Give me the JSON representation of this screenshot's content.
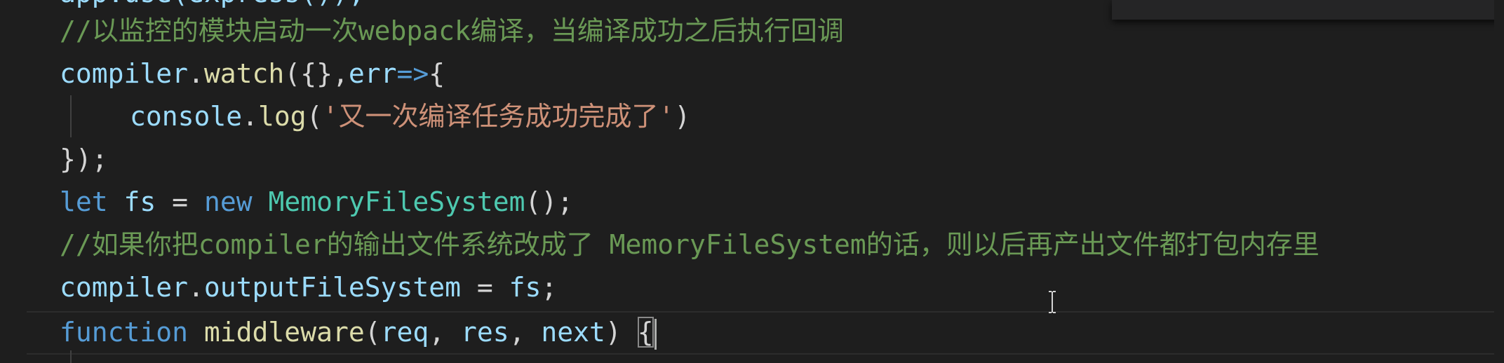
{
  "editor": {
    "partial_top_line": "app.use(express());",
    "lines": [
      {
        "tokens": [
          {
            "t": "//以监控的模块启动一次webpack编译，当编译成功之后执行回调",
            "c": "comment"
          }
        ]
      },
      {
        "tokens": [
          {
            "t": "compiler",
            "c": "var"
          },
          {
            "t": ".",
            "c": "punct"
          },
          {
            "t": "watch",
            "c": "func"
          },
          {
            "t": "({},",
            "c": "punct"
          },
          {
            "t": "err",
            "c": "var"
          },
          {
            "t": "=>",
            "c": "keyword"
          },
          {
            "t": "{",
            "c": "punct"
          }
        ]
      },
      {
        "tokens": [
          {
            "t": "console",
            "c": "var"
          },
          {
            "t": ".",
            "c": "punct"
          },
          {
            "t": "log",
            "c": "func"
          },
          {
            "t": "(",
            "c": "punct"
          },
          {
            "t": "'又一次编译任务成功完成了'",
            "c": "string"
          },
          {
            "t": ")",
            "c": "punct"
          }
        ]
      },
      {
        "tokens": [
          {
            "t": "});",
            "c": "punct"
          }
        ]
      },
      {
        "tokens": [
          {
            "t": "let",
            "c": "keyword"
          },
          {
            "t": " ",
            "c": "punct"
          },
          {
            "t": "fs",
            "c": "var"
          },
          {
            "t": " = ",
            "c": "punct"
          },
          {
            "t": "new",
            "c": "keyword"
          },
          {
            "t": " ",
            "c": "punct"
          },
          {
            "t": "MemoryFileSystem",
            "c": "class"
          },
          {
            "t": "();",
            "c": "punct"
          }
        ]
      },
      {
        "tokens": [
          {
            "t": "//如果你把compiler的输出文件系统改成了 MemoryFileSystem的话，则以后再产出文件都打包内存里",
            "c": "comment"
          }
        ]
      },
      {
        "tokens": [
          {
            "t": "compiler",
            "c": "var"
          },
          {
            "t": ".",
            "c": "punct"
          },
          {
            "t": "outputFileSystem",
            "c": "var"
          },
          {
            "t": " = ",
            "c": "punct"
          },
          {
            "t": "fs",
            "c": "var"
          },
          {
            "t": ";",
            "c": "punct"
          }
        ]
      },
      {
        "tokens": [
          {
            "t": "function",
            "c": "keyword"
          },
          {
            "t": " ",
            "c": "punct"
          },
          {
            "t": "middleware",
            "c": "func"
          },
          {
            "t": "(",
            "c": "punct"
          },
          {
            "t": "req",
            "c": "var"
          },
          {
            "t": ", ",
            "c": "punct"
          },
          {
            "t": "res",
            "c": "var"
          },
          {
            "t": ", ",
            "c": "punct"
          },
          {
            "t": "next",
            "c": "var"
          },
          {
            "t": ") ",
            "c": "punct"
          },
          {
            "t": "{",
            "c": "bracket-match"
          }
        ]
      }
    ]
  },
  "colors": {
    "background": "#1e1e1e",
    "comment": "#6a9955",
    "variable": "#9cdcfe",
    "function": "#dcdcaa",
    "keyword": "#569cd6",
    "class": "#4ec9b0",
    "string": "#ce9178",
    "punctuation": "#d4d4d4"
  },
  "icons": {
    "mouse_pointer": "text-cursor-icon"
  }
}
